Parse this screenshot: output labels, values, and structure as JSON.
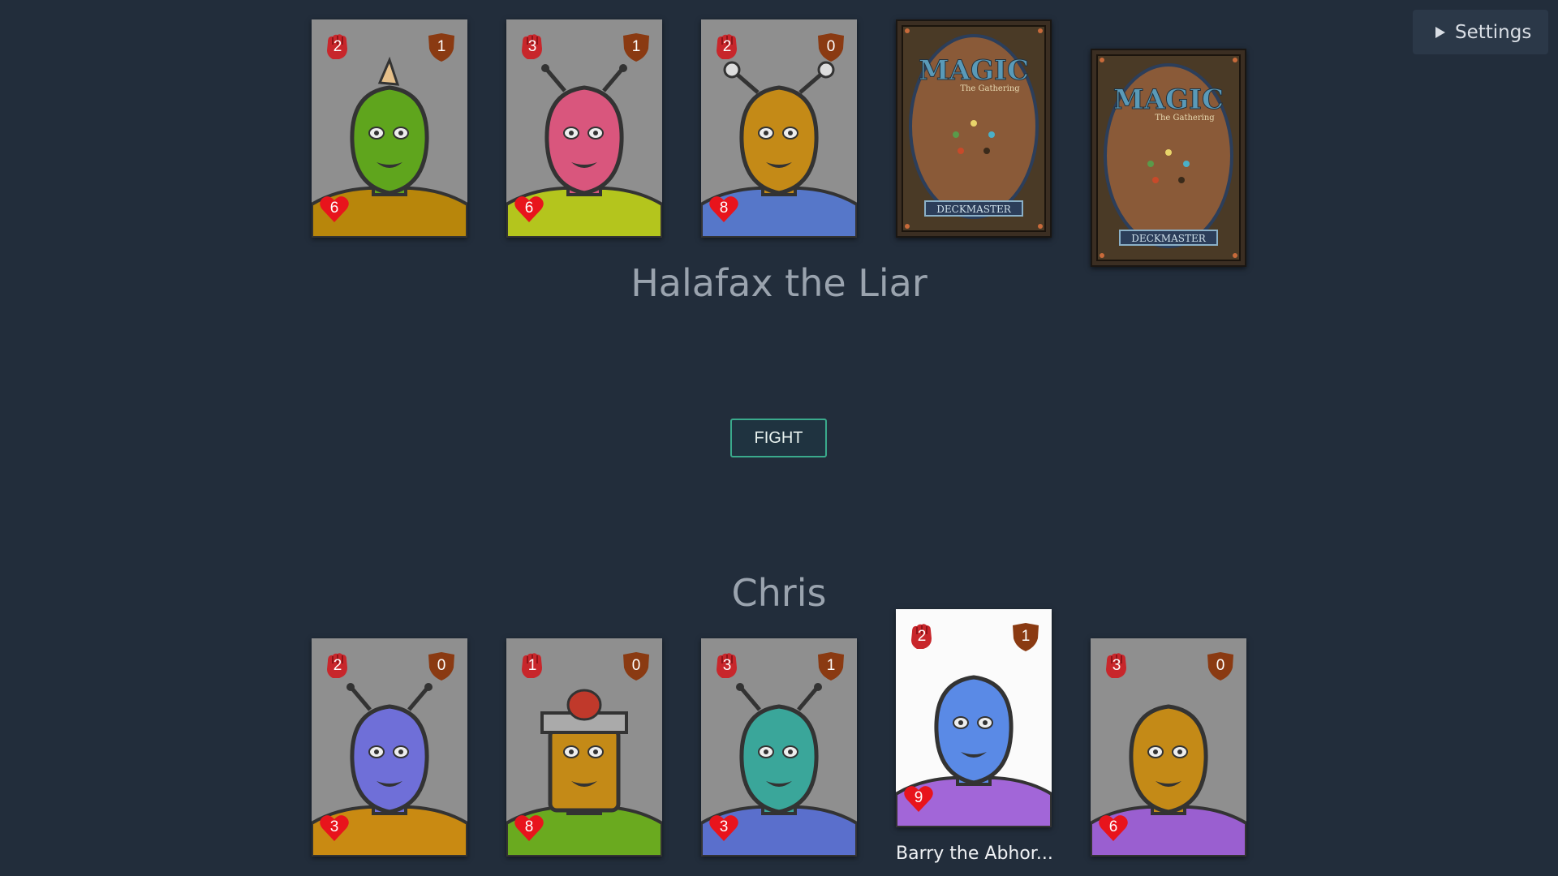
{
  "settings_label": "Settings",
  "fight_label": "FIGHT",
  "opponent": {
    "name": "Halafax the Liar",
    "cards": [
      {
        "attack": "2",
        "defense": "1",
        "health": "6",
        "skin": "#5fa51d",
        "shirt": "#b8860b",
        "feature": "horn"
      },
      {
        "attack": "3",
        "defense": "1",
        "health": "6",
        "skin": "#d9567d",
        "shirt": "#b4c51d",
        "feature": "antennae"
      },
      {
        "attack": "2",
        "defense": "0",
        "health": "8",
        "skin": "#c48a17",
        "shirt": "#5677c9",
        "feature": "eyestalks"
      }
    ],
    "hidden_cards": [
      {
        "logo": "MAGIC",
        "sub": "The Gathering",
        "footer": "DECKMASTER"
      },
      {
        "logo": "MAGIC",
        "sub": "The Gathering",
        "footer": "DECKMASTER"
      }
    ]
  },
  "player": {
    "name": "Chris",
    "cards": [
      {
        "attack": "2",
        "defense": "0",
        "health": "3",
        "skin": "#6f6fd8",
        "shirt": "#c98a12",
        "feature": "antennae",
        "highlight": false
      },
      {
        "attack": "1",
        "defense": "0",
        "health": "8",
        "skin": "#c48a17",
        "shirt": "#6aaa1f",
        "feature": "helmet",
        "highlight": false
      },
      {
        "attack": "3",
        "defense": "1",
        "health": "3",
        "skin": "#3aa69a",
        "shirt": "#5a6fcc",
        "feature": "antennae",
        "highlight": false
      },
      {
        "attack": "2",
        "defense": "1",
        "health": "9",
        "skin": "#5a8ae6",
        "shirt": "#a266d8",
        "feature": "none",
        "highlight": true,
        "caption": "Barry the Abhor..."
      },
      {
        "attack": "3",
        "defense": "0",
        "health": "6",
        "skin": "#c48a17",
        "shirt": "#9a5fd0",
        "feature": "none",
        "highlight": false
      }
    ]
  },
  "colors": {
    "background": "#222d3b",
    "attack_icon": "#c8262b",
    "defense_icon": "#8a3a12",
    "health_icon": "#e8141c",
    "fight_border": "#3aaa8c"
  },
  "icons": {
    "attack": "fist-icon",
    "defense": "shield-icon",
    "health": "heart-icon"
  }
}
